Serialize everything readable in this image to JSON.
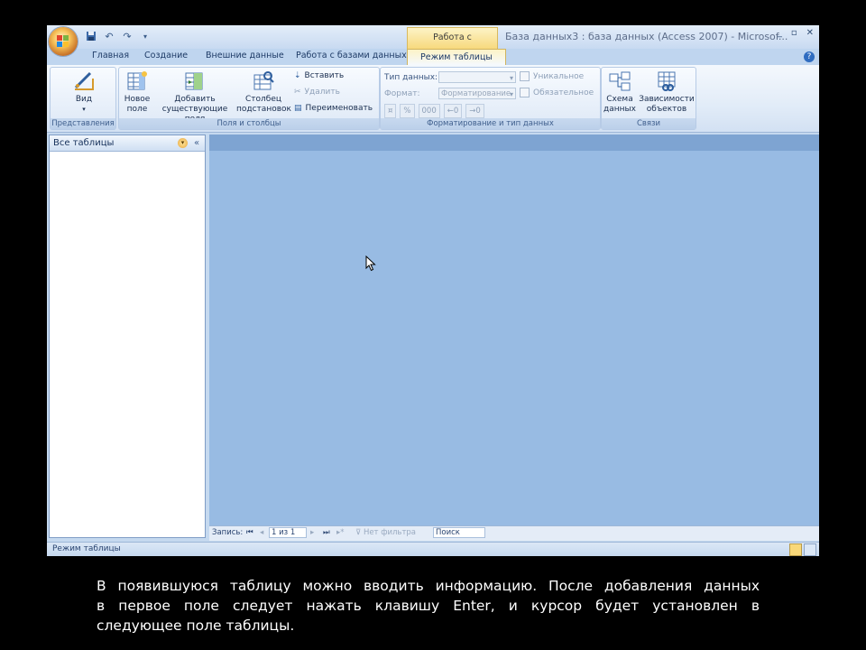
{
  "window": {
    "title": "База данных3 : база данных (Access 2007) - Microsof...",
    "contextual_tab_group": "Работа с таблицами",
    "controls": [
      "_",
      "▫",
      "✕"
    ]
  },
  "tabs": [
    "Главная",
    "Создание",
    "Внешние данные",
    "Работа с базами данных",
    "Режим таблицы"
  ],
  "active_tab": "Режим таблицы",
  "ribbon": {
    "views": {
      "view_label": "Вид",
      "group_label": "Представления"
    },
    "fields": {
      "new_field": [
        "Новое",
        "поле"
      ],
      "add_existing": [
        "Добавить",
        "существующие поля"
      ],
      "lookup_column": [
        "Столбец",
        "подстановок"
      ],
      "insert": "Вставить",
      "delete": "Удалить",
      "rename": "Переименовать",
      "group_label": "Поля и столбцы"
    },
    "format": {
      "data_type_label": "Тип данных:",
      "format_label": "Формат:",
      "format_value": "Форматирование",
      "unique_label": "Уникальное",
      "required_label": "Обязательное",
      "percent": "%",
      "thousands": "000",
      "group_label": "Форматирование и тип данных"
    },
    "relations": {
      "schema": [
        "Схема",
        "данных"
      ],
      "dependencies": [
        "Зависимости",
        "объектов"
      ],
      "group_label": "Связи"
    }
  },
  "nav_pane": {
    "title": "Все таблицы",
    "collapse": "«"
  },
  "record_bar": {
    "label": "Запись:",
    "position": "1 из 1",
    "filter": "Нет фильтра",
    "search": "Поиск"
  },
  "status_bar": {
    "text": "Режим таблицы"
  },
  "caption": {
    "lines": [
      "В появившуюся таблицу можно вводить информацию. После добавления данных",
      "в первое поле следует нажать клавишу Enter, и курсор будет установлен в",
      "следующее поле таблицы."
    ]
  }
}
